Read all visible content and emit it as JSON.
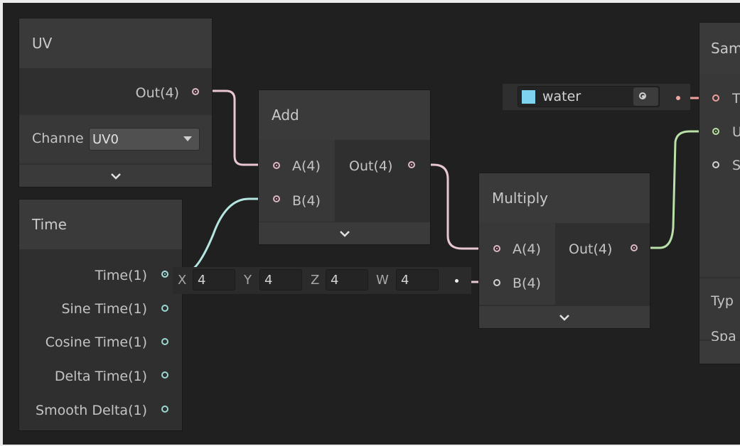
{
  "nodes": {
    "uv": {
      "title": "UV",
      "output_label": "Out(4)",
      "channel_label": "Channe",
      "channel_value": "UV0"
    },
    "time": {
      "title": "Time",
      "outputs": [
        "Time(1)",
        "Sine Time(1)",
        "Cosine Time(1)",
        "Delta Time(1)",
        "Smooth Delta(1)"
      ]
    },
    "add": {
      "title": "Add",
      "inputs": [
        "A(4)",
        "B(4)"
      ],
      "output_label": "Out(4)"
    },
    "multiply": {
      "title": "Multiply",
      "inputs": [
        "A(4)",
        "B(4)"
      ],
      "output_label": "Out(4)"
    },
    "sample": {
      "title": "Sam",
      "inputs": [
        "T",
        "U",
        "S"
      ],
      "props": [
        "Typ",
        "Spa"
      ]
    }
  },
  "vector_field": {
    "x_label": "X",
    "x_value": "4",
    "y_label": "Y",
    "y_value": "4",
    "z_label": "Z",
    "z_value": "4",
    "w_label": "W",
    "w_value": "4"
  },
  "texture_field": {
    "name": "water"
  },
  "colors": {
    "canvas": "#202020",
    "node_body": "#2f2f2f",
    "node_header": "#3a3a3a",
    "vector4_wire": "#e8c6d2",
    "float_wire": "#b6e6e2",
    "vector2_wire": "#b9e0a7",
    "texture_wire": "#f0a09a"
  },
  "icons": {
    "expand": "chevron-down-icon",
    "dropdown": "caret-down-icon",
    "object_picker": "target-icon",
    "texture": "texture-thumbnail-icon"
  }
}
